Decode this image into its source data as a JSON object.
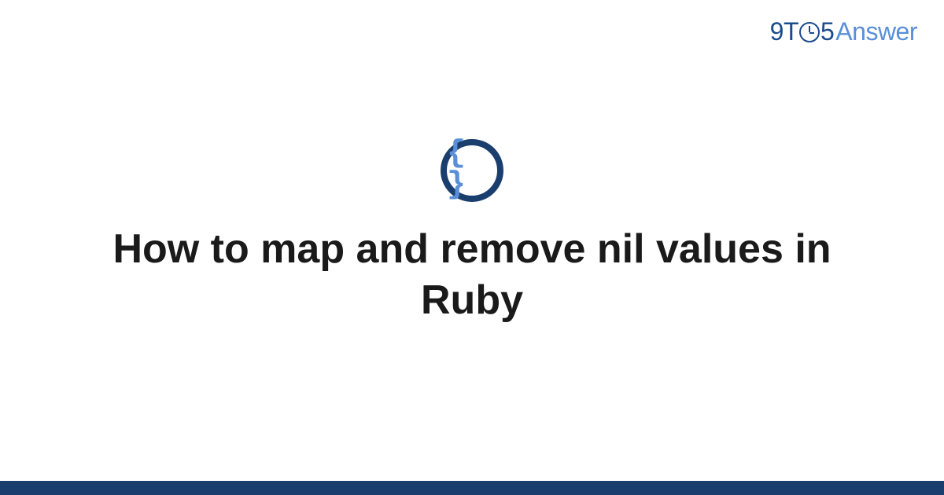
{
  "brand": {
    "part1": "9T",
    "part2": "5",
    "part3": "Answer"
  },
  "icon": {
    "name": "code-braces-icon",
    "glyph": "{ }"
  },
  "title": "How to map and remove nil values in Ruby",
  "colors": {
    "brand_dark": "#1a4b8c",
    "brand_light": "#5a8fd8",
    "ring": "#1a3e6e",
    "footer": "#1a3e6e",
    "text": "#1a1a1a"
  }
}
